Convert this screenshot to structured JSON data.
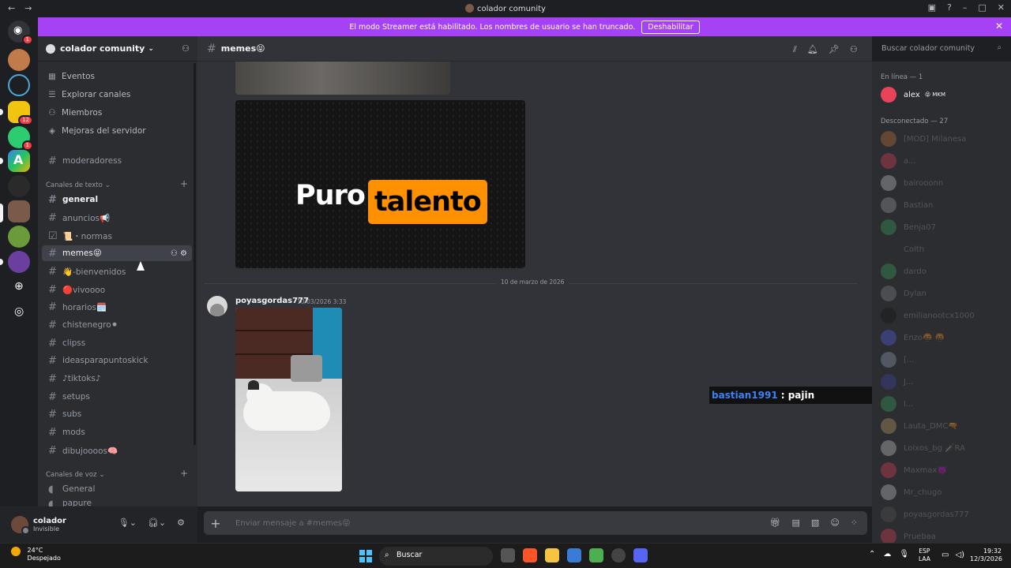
{
  "window": {
    "title": "colador comunity"
  },
  "banner": {
    "text": "El modo Streamer está habilitado. Los nombres de usuario se han truncado.",
    "button": "Deshabilitar"
  },
  "guild": {
    "name": "colador comunity"
  },
  "menu": [
    "Eventos",
    "Explorar canales",
    "Miembros",
    "Mejoras del servidor"
  ],
  "top_channel": "moderadoress",
  "text_category": "Canales de texto",
  "channels": [
    "general",
    "anuncios📢",
    "📜・normas",
    "memes😝",
    "👋-bienvenidos",
    "🔴vivoooo",
    "horarios🗓️",
    "chistenegro⚫",
    "clipss",
    "ideasparapuntoskick",
    "♪tiktoks♪",
    "setups",
    "subs",
    "mods",
    "dibujoooos🧠"
  ],
  "voice_category": "Canales de voz",
  "voice_channels": [
    "General",
    "papure"
  ],
  "user": {
    "name": "colador",
    "status": "Invisible"
  },
  "chat": {
    "channel": "memes😝",
    "search_placeholder": "Buscar colador comunity",
    "meme_word1": "Puro",
    "meme_word2": "talento",
    "date_divider": "10 de marzo de 2026",
    "author": "poyasgordas777",
    "timestamp": "10/03/2026 3:33",
    "composer_placeholder": "Enviar mensaje a #memes😝"
  },
  "overlay": {
    "user": "bastian1991",
    "message": ": pajin"
  },
  "members": {
    "online_header": "En línea — 1",
    "online": [
      {
        "name": "alex",
        "tag": "😝 MKM",
        "color": "#e9435a"
      }
    ],
    "offline_header": "Desconectado — 27",
    "offline": [
      {
        "name": "[MOD] Milanesa",
        "color": "#c97a3a"
      },
      {
        "name": "a...",
        "color": "#e9435a"
      },
      {
        "name": "bairooonn",
        "color": "#cfcfcf"
      },
      {
        "name": "Bastian",
        "color": "#a0a0a0"
      },
      {
        "name": "Benja07",
        "color": "#3ba55c"
      },
      {
        "name": "Colth",
        "color": "#2b2d31"
      },
      {
        "name": "dardo",
        "color": "#3ba55c"
      },
      {
        "name": "Dylan",
        "color": "#8a8a8a"
      },
      {
        "name": "emilianootcx1000",
        "color": "#111111"
      },
      {
        "name": "Enzo🤬 🤬",
        "color": "#5865f2"
      },
      {
        "name": "[...",
        "color": "#9ab"
      },
      {
        "name": "J...",
        "color": "#44a"
      },
      {
        "name": "l...",
        "color": "#3ba55c"
      },
      {
        "name": "Lauta_DMC🔫",
        "color": "#c9a36b"
      },
      {
        "name": "Lolxos_bg 🗡️RA",
        "color": "#d0d0d0"
      },
      {
        "name": "Maxmax👿",
        "color": "#e9435a"
      },
      {
        "name": "Mr_chugo",
        "color": "#cfcfcf"
      },
      {
        "name": "poyasgordas777",
        "color": "#555"
      },
      {
        "name": "Pruebaa",
        "color": "#e9435a"
      }
    ]
  },
  "taskbar": {
    "temp": "24°C",
    "weather": "Despejado",
    "search": "Buscar",
    "lang1": "ESP",
    "lang2": "LAA",
    "time": "19:32",
    "date": "12/3/2026"
  },
  "badges": {
    "discord": "1",
    "server2": "12",
    "server3": "1"
  }
}
